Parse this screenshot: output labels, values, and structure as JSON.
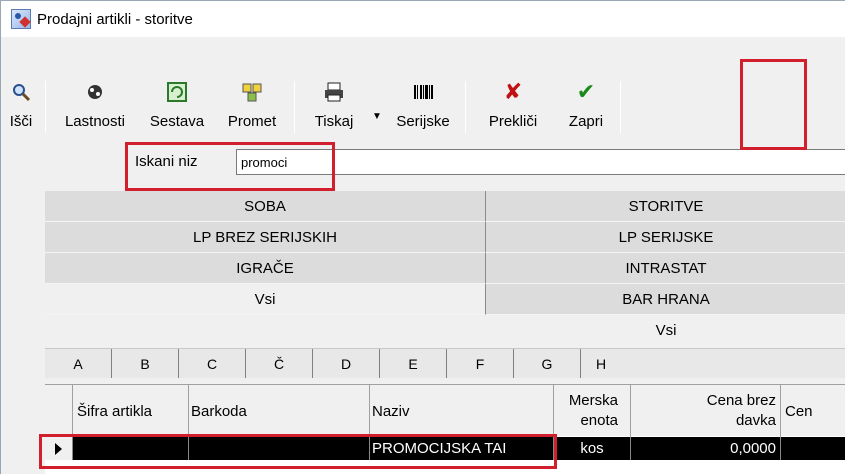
{
  "window": {
    "title": "Prodajni artikli - storitve"
  },
  "toolbar": {
    "isci": "Išči",
    "lastnosti": "Lastnosti",
    "sestava": "Sestava",
    "promet": "Promet",
    "tiskaj": "Tiskaj",
    "serijske": "Serijske",
    "preklici": "Prekliči",
    "zapri": "Zapri"
  },
  "search": {
    "label": "Iskani niz",
    "value": "promoci"
  },
  "categories": {
    "left": [
      "SOBA",
      "LP BREZ SERIJSKIH",
      "IGRAČE",
      "Vsi"
    ],
    "right": [
      "STORITVE",
      "LP SERIJSKE",
      "INTRASTAT",
      "BAR HRANA"
    ],
    "bottom": "Vsi"
  },
  "letters": [
    "A",
    "B",
    "C",
    "Č",
    "D",
    "E",
    "F",
    "G",
    "H"
  ],
  "table": {
    "headers": {
      "sifra": "Šifra artikla",
      "barkoda": "Barkoda",
      "naziv": "Naziv",
      "merska_1": "Merska",
      "merska_2": "enota",
      "cena_1": "Cena brez",
      "cena_2": "davka",
      "cena2": "Cen"
    },
    "rows": [
      {
        "sifra": "",
        "barkoda": "",
        "naziv": "PROMOCIJSKA TAI",
        "merska": "kos",
        "cena": "0,0000",
        "cena2": ""
      }
    ]
  },
  "colors": {
    "highlight": "#d11f2e",
    "check": "#1a8a1a",
    "cross": "#c01010"
  }
}
